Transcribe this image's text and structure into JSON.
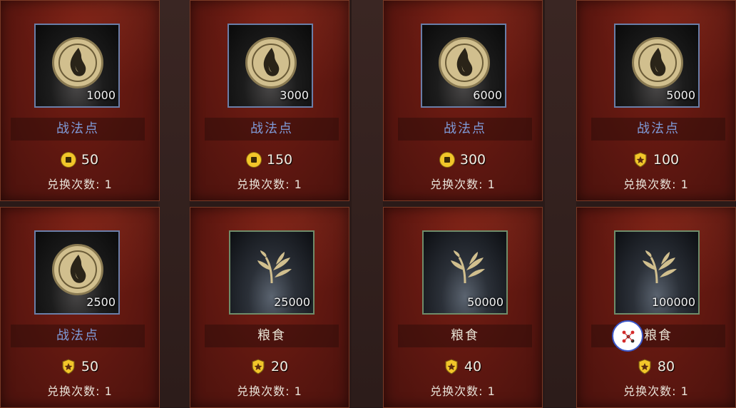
{
  "items": [
    {
      "name": "战法点",
      "type": "tactic",
      "amount": "1000",
      "currency": "coin",
      "price": "50",
      "limit_label": "兑换次数:",
      "limit_value": "1"
    },
    {
      "name": "战法点",
      "type": "tactic",
      "amount": "3000",
      "currency": "coin",
      "price": "150",
      "limit_label": "兑换次数:",
      "limit_value": "1"
    },
    {
      "name": "战法点",
      "type": "tactic",
      "amount": "6000",
      "currency": "coin",
      "price": "300",
      "limit_label": "兑换次数:",
      "limit_value": "1"
    },
    {
      "name": "战法点",
      "type": "tactic",
      "amount": "5000",
      "currency": "shield",
      "price": "100",
      "limit_label": "兑换次数:",
      "limit_value": "1"
    },
    {
      "name": "战法点",
      "type": "tactic",
      "amount": "2500",
      "currency": "shield",
      "price": "50",
      "limit_label": "兑换次数:",
      "limit_value": "1"
    },
    {
      "name": "粮食",
      "type": "grain",
      "amount": "25000",
      "currency": "shield",
      "price": "20",
      "limit_label": "兑换次数:",
      "limit_value": "1"
    },
    {
      "name": "粮食",
      "type": "grain",
      "amount": "50000",
      "currency": "shield",
      "price": "40",
      "limit_label": "兑换次数:",
      "limit_value": "1"
    },
    {
      "name": "粮食",
      "type": "grain",
      "amount": "100000",
      "currency": "shield",
      "price": "80",
      "limit_label": "兑换次数:",
      "limit_value": "1"
    }
  ],
  "colors": {
    "card_bg": "#5e1710",
    "tactic_label": "#7f9bd8",
    "grain_label": "#e6e0d2",
    "coin": "#f2c62a",
    "frame_blue": "#6a7ea8",
    "frame_green": "#6f8c6a"
  },
  "icons": {
    "tactic": "flame-emblem-icon",
    "grain": "grain-sprout-icon",
    "coin": "coin-icon",
    "shield": "shield-token-icon",
    "float": "assistant-button-icon"
  }
}
